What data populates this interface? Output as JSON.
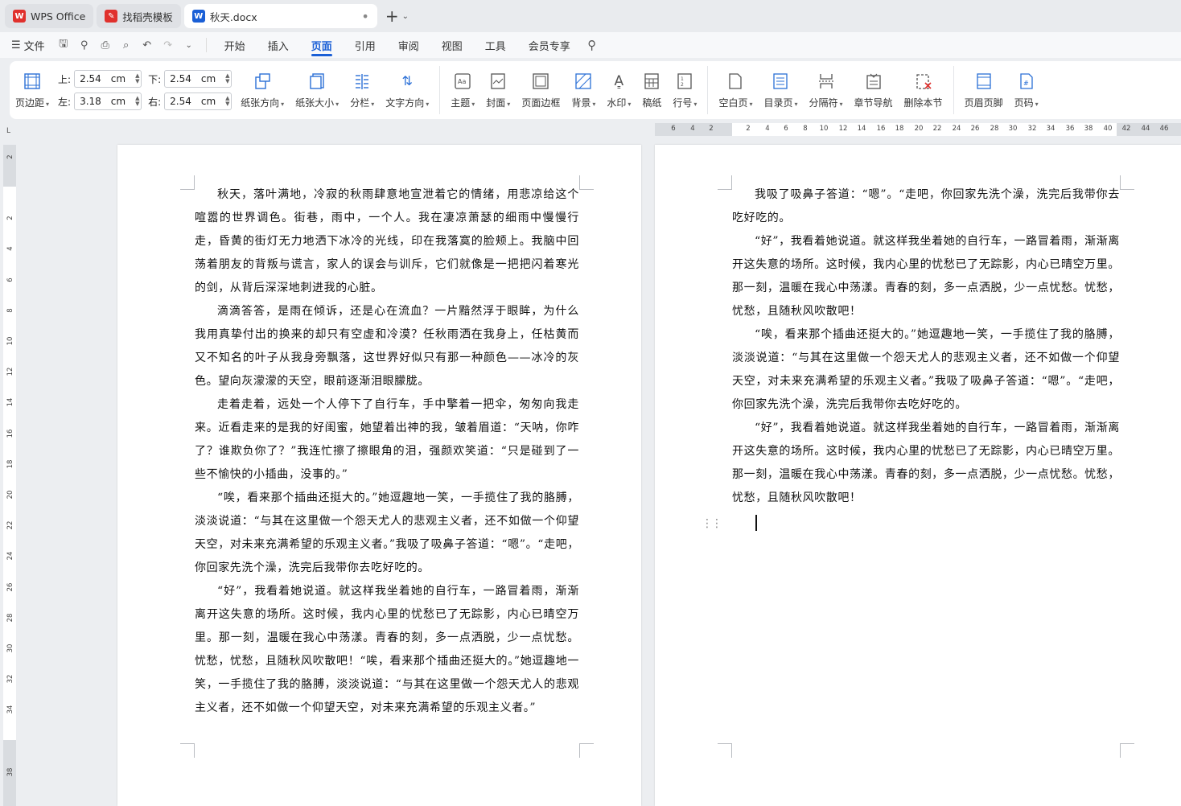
{
  "tabs": [
    {
      "label": "WPS Office",
      "icon": "wps-logo-icon",
      "color": "#e0312d"
    },
    {
      "label": "找稻壳模板",
      "icon": "docer-logo-icon",
      "color": "#e0312d"
    },
    {
      "label": "秋天.docx",
      "icon": "word-doc-icon",
      "color": "#1a5fd6"
    }
  ],
  "menubar": {
    "file_label": "文件",
    "tabs": [
      "开始",
      "插入",
      "页面",
      "引用",
      "审阅",
      "视图",
      "工具",
      "会员专享"
    ],
    "active_tab": "页面"
  },
  "ribbon": {
    "margins_label": "页边距",
    "top_label": "上:",
    "top_value": "2.54",
    "bottom_label": "下:",
    "bottom_value": "2.54",
    "left_label": "左:",
    "left_value": "3.18",
    "right_label": "右:",
    "right_value": "2.54",
    "unit": "cm",
    "orientation": "纸张方向",
    "size": "纸张大小",
    "columns": "分栏",
    "text_direction": "文字方向",
    "theme": "主题",
    "cover": "封面",
    "page_border": "页面边框",
    "background": "背景",
    "watermark": "水印",
    "manuscript": "稿纸",
    "line_number": "行号",
    "blank_page": "空白页",
    "toc_page": "目录页",
    "break": "分隔符",
    "chapter_nav": "章节导航",
    "delete_section": "删除本节",
    "header_footer": "页眉页脚",
    "page_number": "页码"
  },
  "ruler": {
    "h_ticks": [
      "6",
      "4",
      "2",
      "2",
      "4",
      "6",
      "8",
      "10",
      "12",
      "14",
      "16",
      "18",
      "20",
      "22",
      "24",
      "26",
      "28",
      "30",
      "32",
      "34",
      "36",
      "38",
      "40",
      "42",
      "44",
      "46"
    ],
    "v_ticks": [
      "2",
      "2",
      "4",
      "6",
      "8",
      "10",
      "12",
      "14",
      "16",
      "18",
      "20",
      "22",
      "24",
      "26",
      "28",
      "30",
      "32",
      "34",
      "38"
    ],
    "corner": "L"
  },
  "page1": {
    "paragraphs": [
      "秋天，落叶满地，冷寂的秋雨肆意地宣泄着它的情绪，用悲凉给这个喧嚣的世界调色。街巷，雨中，一个人。我在凄凉萧瑟的细雨中慢慢行走，昏黄的街灯无力地洒下冰冷的光线，印在我落寞的脸颊上。我脑中回荡着朋友的背叛与谎言，家人的误会与训斥，它们就像是一把把闪着寒光的剑，从背后深深地刺进我的心脏。",
      "滴滴答答，是雨在倾诉，还是心在流血？一片黯然浮于眼眸，为什么我用真挚付出的换来的却只有空虚和冷漠？任秋雨洒在我身上，任枯黄而又不知名的叶子从我身旁飘落，这世界好似只有那一种颜色——冰冷的灰色。望向灰濛濛的天空，眼前逐渐泪眼朦胧。",
      "走着走着，远处一个人停下了自行车，手中擎着一把伞，匆匆向我走来。近看走来的是我的好闺蜜，她望着出神的我，皱着眉道：“天呐，你咋了？谁欺负你了？”我连忙擦了擦眼角的泪，强颜欢笑道：“只是碰到了一些不愉快的小插曲，没事的。”",
      "“唉，看来那个插曲还挺大的。”她逗趣地一笑，一手揽住了我的胳膊，淡淡说道：“与其在这里做一个怨天尤人的悲观主义者，还不如做一个仰望天空，对未来充满希望的乐观主义者。”我吸了吸鼻子答道：“嗯”。“走吧，你回家先洗个澡，洗完后我带你去吃好吃的。",
      "“好”，我看着她说道。就这样我坐着她的自行车，一路冒着雨，渐渐离开这失意的场所。这时候，我内心里的忧愁已了无踪影，内心已晴空万里。那一刻，温暖在我心中荡漾。青春的刻，多一点洒脱，少一点忧愁。忧愁，忧愁，且随秋风吹散吧！“唉，看来那个插曲还挺大的。”她逗趣地一笑，一手揽住了我的胳膊，淡淡说道：“与其在这里做一个怨天尤人的悲观主义者，还不如做一个仰望天空，对未来充满希望的乐观主义者。”"
    ]
  },
  "page2": {
    "paragraphs": [
      "我吸了吸鼻子答道：“嗯”。“走吧，你回家先洗个澡，洗完后我带你去吃好吃的。",
      "“好”，我看着她说道。就这样我坐着她的自行车，一路冒着雨，渐渐离开这失意的场所。这时候，我内心里的忧愁已了无踪影，内心已晴空万里。那一刻，温暖在我心中荡漾。青春的刻，多一点洒脱，少一点忧愁。忧愁，忧愁，且随秋风吹散吧！",
      "“唉，看来那个插曲还挺大的。”她逗趣地一笑，一手揽住了我的胳膊，淡淡说道：“与其在这里做一个怨天尤人的悲观主义者，还不如做一个仰望天空，对未来充满希望的乐观主义者。”我吸了吸鼻子答道：“嗯”。“走吧，你回家先洗个澡，洗完后我带你去吃好吃的。",
      "“好”，我看着她说道。就这样我坐着她的自行车，一路冒着雨，渐渐离开这失意的场所。这时候，我内心里的忧愁已了无踪影，内心已晴空万里。那一刻，温暖在我心中荡漾。青春的刻，多一点洒脱，少一点忧愁。忧愁，忧愁，且随秋风吹散吧！"
    ]
  }
}
